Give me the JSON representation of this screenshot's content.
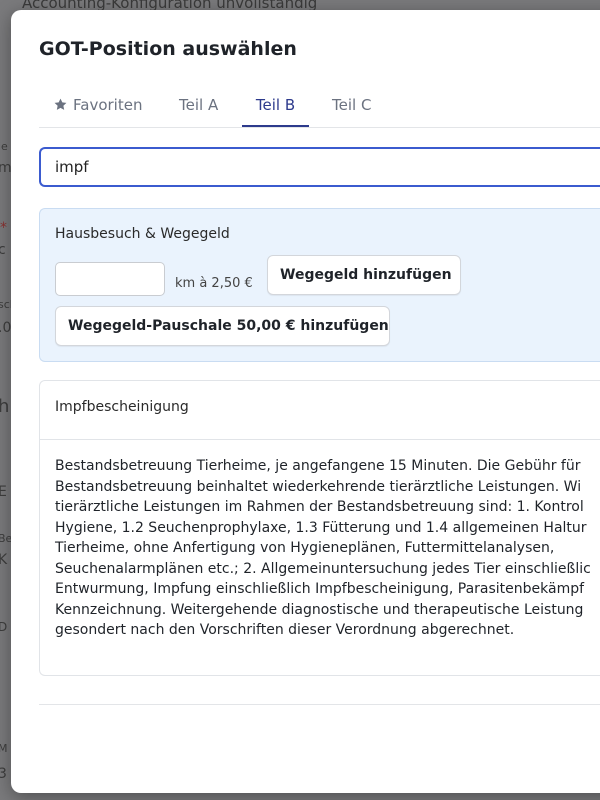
{
  "background": {
    "page_title": "Accounting-Konfiguration unvollständig",
    "fragments": [
      "ie",
      "m",
      "*",
      "c",
      "sch",
      ".0",
      "h",
      "E",
      "Be",
      "K",
      "D",
      "M",
      "3"
    ]
  },
  "modal": {
    "title": "GOT-Position auswählen",
    "tabs": [
      {
        "label": "Favoriten",
        "icon": "star-icon",
        "active": false
      },
      {
        "label": "Teil A",
        "active": false
      },
      {
        "label": "Teil B",
        "active": true
      },
      {
        "label": "Teil C",
        "active": false
      }
    ],
    "search": {
      "value": "impf",
      "placeholder": ""
    },
    "house_visit": {
      "title": "Hausbesuch & Wegegeld",
      "km_value": "",
      "km_label": "km à 2,50 €",
      "add_button": "Wegegeld hinzufügen",
      "flat_button": "Wegegeld-Pauschale 50,00 € hinzufügen"
    },
    "result": {
      "title": "Impfbescheinigung",
      "description_lines": [
        "Bestandsbetreuung Tierheime, je angefangene 15 Minuten. Die Gebühr für",
        "Bestandsbetreuung beinhaltet wiederkehrende tierärztliche Leistungen. Wi",
        "tierärztliche Leistungen im Rahmen der Bestandsbetreuung sind: 1. Kontrol",
        "Hygiene, 1.2 Seuchenprophylaxe, 1.3 Fütterung und 1.4 allgemeinen Haltur",
        "Tierheime, ohne Anfertigung von Hygieneplänen, Futtermittelanalysen,",
        "Seuchenalarmplänen etc.; 2. Allgemeinuntersuchung jedes Tier einschließlic",
        "Entwurmung, Impfung einschließlich Impfbescheinigung, Parasitenbekämpf",
        "Kennzeichnung. Weitergehende diagnostische und therapeutische Leistung",
        "gesondert nach den Vorschriften dieser Verordnung abgerechnet."
      ]
    }
  },
  "colors": {
    "accent": "#2d3a8c",
    "focus_border": "#3b5bcf",
    "panel_bg": "#eaf3fd",
    "overlay": "#7a7a7c"
  }
}
